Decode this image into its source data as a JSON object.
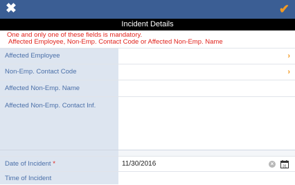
{
  "topbar": {
    "close_glyph": "✖",
    "confirm_glyph": "✔"
  },
  "section": {
    "title": "Incident Details"
  },
  "notice": {
    "line1": "One and only one of these fields is mandatory.",
    "line2": "Affected Employee, Non-Emp. Contact Code or Affected Non-Emp. Name"
  },
  "fields": {
    "affected_employee": {
      "label": "Affected Employee",
      "value": ""
    },
    "non_emp_contact_code": {
      "label": "Non-Emp. Contact Code",
      "value": ""
    },
    "affected_non_emp_name": {
      "label": "Affected Non-Emp. Name",
      "value": ""
    },
    "non_emp_contact_inf": {
      "label": "Affected Non-Emp. Contact Inf.",
      "value": ""
    },
    "date_of_incident": {
      "label": "Date of Incident",
      "required_marker": "*",
      "value": "11/30/2016",
      "calendar_day": "31"
    },
    "time_of_incident": {
      "label": "Time of Incident",
      "value": ""
    }
  },
  "icons": {
    "chevron": "›",
    "clear": "×"
  },
  "colors": {
    "header_bg": "#3b5e94",
    "accent": "#f39a22",
    "label_bg": "#dde5f0",
    "label_text": "#4a6fa8",
    "error": "#e0221b"
  }
}
